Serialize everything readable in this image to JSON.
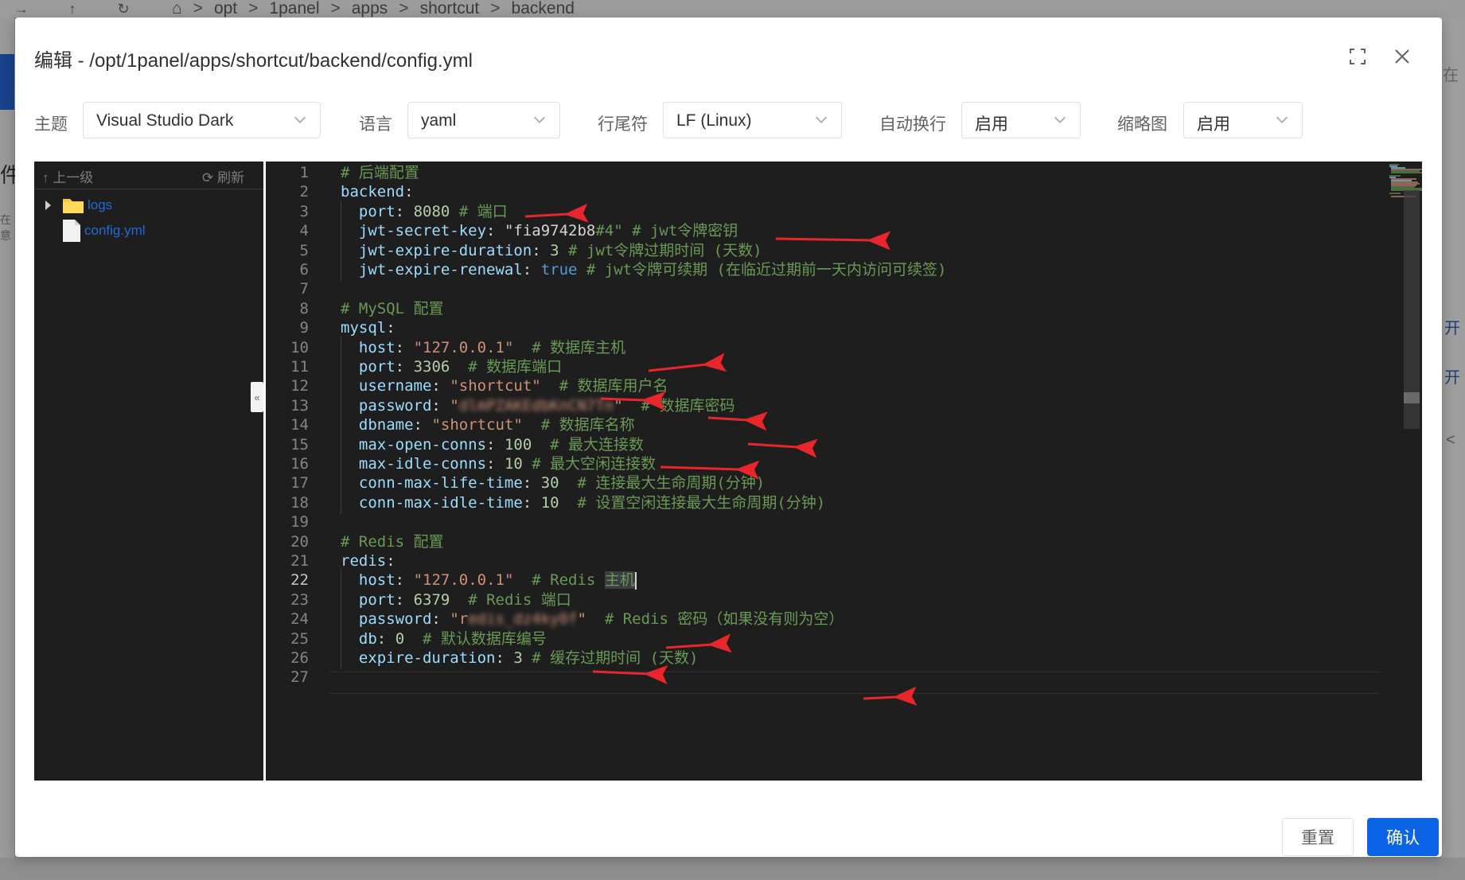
{
  "background": {
    "breadcrumbs": [
      "opt",
      "1panel",
      "apps",
      "shortcut",
      "backend"
    ],
    "breadcrumb_sep": ">",
    "left_text": "件",
    "left_text2": "在意",
    "right_text_top": "在",
    "right_link_1": "开",
    "right_link_2": "开",
    "right_chevron": "<"
  },
  "dialog": {
    "title": "编辑 - /opt/1panel/apps/shortcut/backend/config.yml",
    "fullscreen_icon": "fullscreen-icon",
    "close_icon": "close-icon"
  },
  "toolbar": {
    "theme_label": "主题",
    "theme_value": "Visual Studio Dark",
    "language_label": "语言",
    "language_value": "yaml",
    "eol_label": "行尾符",
    "eol_value": "LF (Linux)",
    "wrap_label": "自动换行",
    "wrap_value": "启用",
    "minimap_label": "缩略图",
    "minimap_value": "启用"
  },
  "tree": {
    "up_label": "上一级",
    "refresh_label": "刷新",
    "items": [
      {
        "name": "logs",
        "type": "folder",
        "icon": "folder-icon"
      },
      {
        "name": "config.yml",
        "type": "file",
        "icon": "file-icon"
      }
    ]
  },
  "editor": {
    "current_line": 22,
    "lines": [
      "# 后端配置",
      "backend:",
      "  port: 8080 # 端口",
      "  jwt-secret-key: \"fia9742b8#4\" # jwt令牌密钥",
      "  jwt-expire-duration: 3 # jwt令牌过期时间 (天数)",
      "  jwt-expire-renewal: true # jwt令牌可续期 (在临近过期前一天内访问可续签)",
      "",
      "# MySQL 配置",
      "mysql:",
      "  host: \"127.0.0.1\"  # 数据库主机",
      "  port: 3306  # 数据库端口",
      "  username: \"shortcut\"  # 数据库用户名",
      "  password: \"dlmPZAKEdbKnCN7Tn\"  # 数据库密码",
      "  dbname: \"shortcut\"  # 数据库名称",
      "  max-open-conns: 100  # 最大连接数",
      "  max-idle-conns: 10 # 最大空闲连接数",
      "  conn-max-life-time: 30  # 连接最大生命周期(分钟)",
      "  conn-max-idle-time: 10  # 设置空闲连接最大生命周期(分钟)",
      "",
      "# Redis 配置",
      "redis:",
      "  host: \"127.0.0.1\"  # Redis 主机",
      "  port: 6379  # Redis 端口",
      "  password: \"redis_dz4ky0f\"  # Redis 密码（如果没有则为空）",
      "  db: 0  # 默认数据库编号",
      "  expire-duration: 3 # 缓存过期时间 (天数)",
      ""
    ]
  },
  "buttons": {
    "reset": "重置",
    "confirm": "确认"
  }
}
